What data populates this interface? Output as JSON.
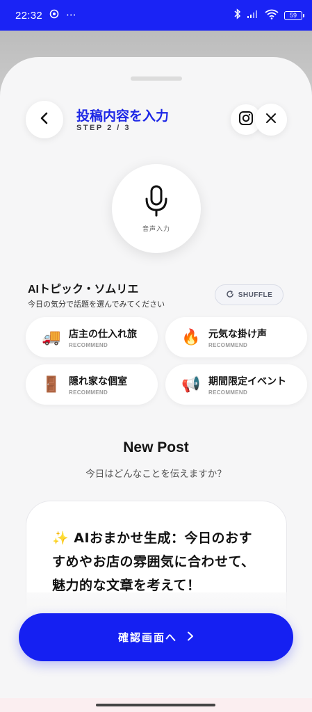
{
  "status_bar": {
    "time": "22:32",
    "dots": "···",
    "battery": "59"
  },
  "header": {
    "title": "投稿内容を入力",
    "step": "STEP 2 / 3"
  },
  "mic": {
    "label": "音声入力"
  },
  "topics": {
    "title": "AIトピック・ソムリエ",
    "subtitle": "今日の気分で話題を選んでみてください",
    "shuffle_label": "SHUFFLE",
    "items": [
      {
        "icon": "🚚",
        "icon_name": "delivery-truck-icon",
        "label": "店主の仕入れ旅",
        "tag": "RECOMMEND"
      },
      {
        "icon": "🔥",
        "icon_name": "fire-icon",
        "label": "元気な掛け声",
        "tag": "RECOMMEND"
      },
      {
        "icon": "🚪",
        "icon_name": "door-icon",
        "label": "隠れ家な個室",
        "tag": "RECOMMEND"
      },
      {
        "icon": "📢",
        "icon_name": "megaphone-icon",
        "label": "期間限定イベント",
        "tag": "RECOMMEND"
      }
    ]
  },
  "new_post": {
    "title": "New Post",
    "subtitle": "今日はどんなことを伝えますか？",
    "body": "✨ AIおまかせ生成：今日のおすすめやお店の雰囲気に合わせて、魅力的な文章を考えて！"
  },
  "footer": {
    "confirm_label": "確認画面へ"
  },
  "colors": {
    "accent": "#1a23f5",
    "title_blue": "#1d27e6"
  }
}
